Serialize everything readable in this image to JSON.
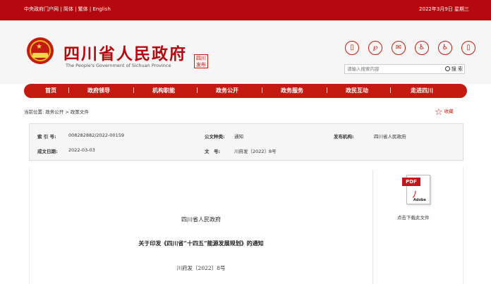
{
  "topbar": {
    "portal": "中央政府门户网",
    "simplified": "简体",
    "traditional": "繁体",
    "english": "English",
    "sep": "|",
    "date": "2022年3月9日 星期三"
  },
  "header": {
    "title": "四川省人民政府",
    "subtitle": "The People's Government of Sichuan Province",
    "seal_text": "四川发布",
    "search_placeholder": "请输入搜索内容",
    "search_button": "搜 索"
  },
  "tools": [
    {
      "icon": "mobile-icon",
      "glyph": "▯"
    },
    {
      "icon": "weibo-icon",
      "glyph": "℘"
    },
    {
      "icon": "wechat-icon",
      "glyph": "✉"
    },
    {
      "icon": "accessibility-icon",
      "glyph": "♿"
    },
    {
      "icon": "elderly-mode-icon",
      "glyph": "♿"
    },
    {
      "icon": "exit-icon",
      "glyph": "▯"
    }
  ],
  "nav": {
    "items": [
      "首页",
      "政府领导",
      "机构职能",
      "政务公开",
      "政务服务",
      "政民互动",
      "走进四川"
    ],
    "sep": "|"
  },
  "breadcrumb": "当前位置: 政务公开 > 政策文件",
  "favorite_label": "收藏",
  "meta": {
    "index_label": "索 引 号:",
    "index_value": "008282882/2022-00159",
    "type_label": "公文种类:",
    "type_value": "通知",
    "issuer_label": "发布机构:",
    "issuer_value": "四川省人民政府",
    "date_label": "成文日期:",
    "date_value": "2022-03-03",
    "docno_label": "文　号:",
    "docno_value": "川府发〔2022〕8号"
  },
  "document": {
    "org": "四川省人民政府",
    "title": "关于印发《四川省“十四五”能源发展规划》的通知",
    "number": "川府发〔2022〕8号"
  },
  "download": {
    "pdf_tag": "PDF",
    "adobe": "Adobe",
    "label": "点击下载此文件"
  },
  "colors": {
    "brand_red": "#b5080e",
    "nav_red": "#c41a0f"
  }
}
